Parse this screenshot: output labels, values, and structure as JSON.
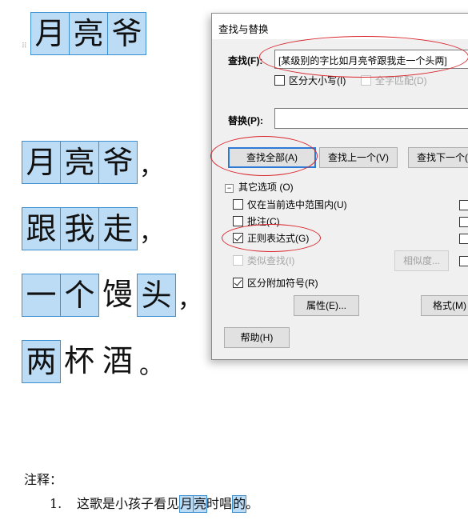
{
  "document": {
    "title_chars": [
      "月",
      "亮",
      "爷"
    ],
    "verses": [
      {
        "chars": [
          "月",
          "亮",
          "爷"
        ],
        "highlight": [
          true,
          true,
          true
        ],
        "punct": "，"
      },
      {
        "chars": [
          "跟",
          "我",
          "走"
        ],
        "highlight": [
          true,
          true,
          true
        ],
        "punct": "，"
      },
      {
        "chars": [
          "一",
          "个",
          "馒",
          "头"
        ],
        "highlight": [
          true,
          true,
          false,
          true
        ],
        "punct": "，"
      },
      {
        "chars": [
          "两",
          "杯",
          "酒"
        ],
        "highlight": [
          true,
          false,
          false
        ],
        "punct": "。"
      }
    ],
    "note_label": "注释：",
    "note_item": {
      "number": "1.",
      "prefix": "这歌是小孩子看见",
      "hl1": "月",
      "hl2": "亮",
      "middle": "时唱",
      "hl3": "的",
      "suffix": "。"
    },
    "anchor_icon": "paragraph-anchor-icon",
    "highlight_color": "#bcdcf6",
    "highlight_border": "#3e8fd0"
  },
  "dialog": {
    "title": "查找与替换",
    "find_label": "查找(F):",
    "find_value": "[某级别的字比如月亮爷跟我走一个头两]",
    "case_sensitive": "区分大小写(I)",
    "whole_word": "全字匹配(D)",
    "replace_label": "替换(P):",
    "replace_value": "",
    "find_all": "查找全部(A)",
    "find_prev": "查找上一个(V)",
    "find_next": "查找下一个(",
    "other_options": "其它选项 (O)",
    "collapse_glyph": "−",
    "only_selection": "仅在当前选中范围内(U)",
    "comments": "批注(C)",
    "regex": "正则表达式(G)",
    "similar_search": "类似查找(I)",
    "similarity_btn": "相似度...",
    "distinguish_diacritics": "区分附加符号(R)",
    "properties_btn": "属性(E)...",
    "format_btn": "格式(M)",
    "help_btn": "帮助(H)",
    "annotation_color": "#d9262d"
  }
}
